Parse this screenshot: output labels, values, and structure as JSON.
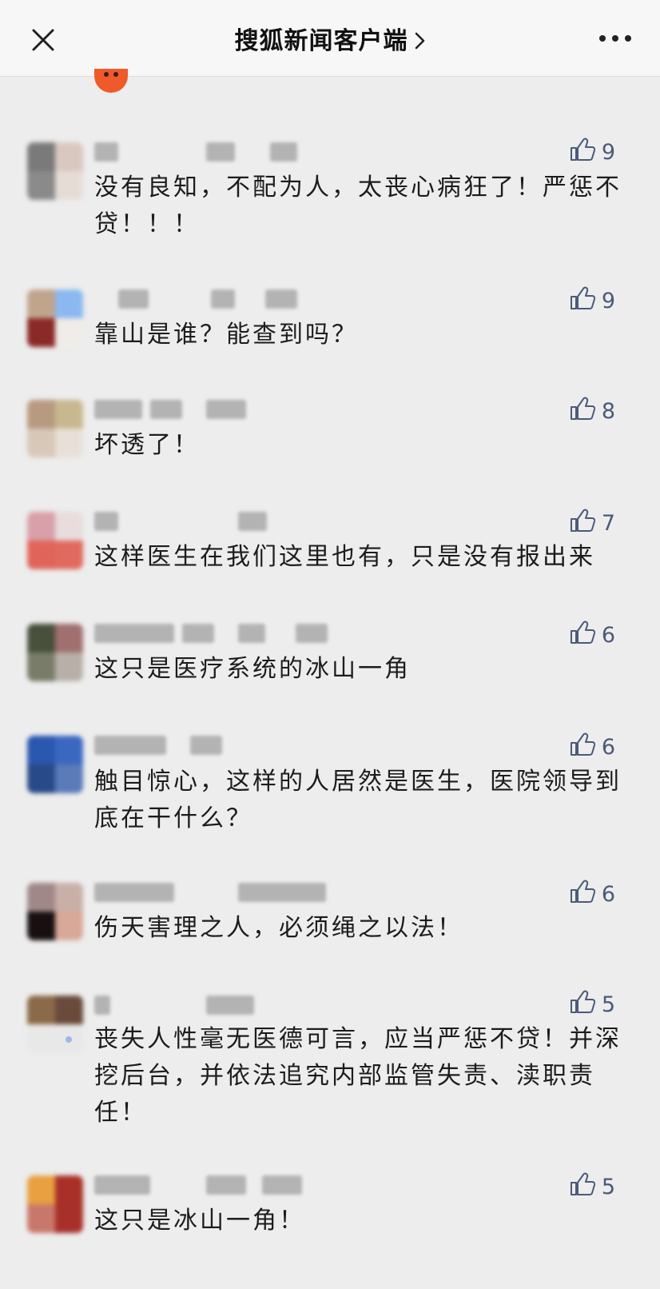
{
  "navbar": {
    "title": "搜狐新闻客户端",
    "close_icon": "close-icon",
    "chevron_icon": "chevron-right-icon",
    "more_icon": "more-icon"
  },
  "comments": [
    {
      "text": "没有良知，不配为人，太丧心病狂了！严惩不贷！！！",
      "likes": "9",
      "avatar_colors": [
        "#7a7a7a",
        "#d8c8c0",
        "#8a8a8a",
        "#e6dcd6"
      ]
    },
    {
      "text": "靠山是谁？能查到吗？",
      "likes": "9",
      "avatar_colors": [
        "#c0a48c",
        "#8bb8f0",
        "#8a2a28",
        "#f0ece8"
      ]
    },
    {
      "text": "坏透了！",
      "likes": "8",
      "avatar_colors": [
        "#b89a80",
        "#c8b890",
        "#d8c8b8",
        "#e8e0d8"
      ]
    },
    {
      "text": "这样医生在我们这里也有，只是没有报出来",
      "likes": "7",
      "avatar_colors": [
        "#d8a0a8",
        "#e8dcdc",
        "#e0645a",
        "#e06a5e"
      ]
    },
    {
      "text": "这只是医疗系统的冰山一角",
      "likes": "6",
      "avatar_colors": [
        "#48503c",
        "#a07070",
        "#787c68",
        "#b8b0a8"
      ]
    },
    {
      "text": "触目惊心，这样的人居然是医生，医院领导到底在干什么？",
      "likes": "6",
      "avatar_colors": [
        "#2a58b0",
        "#3a68c0",
        "#284a88",
        "#5a7ab8"
      ]
    },
    {
      "text": "伤天害理之人，必须绳之以法！",
      "likes": "6",
      "avatar_colors": [
        "#a08888",
        "#c8b0a8",
        "#181010",
        "#d8a898"
      ]
    },
    {
      "text": "丧失人性毫无医德可言，应当严惩不贷！并深挖后台，并依法追究内部监管失责、渎职责任！",
      "likes": "5",
      "avatar_colors": [
        "#8a6a48",
        "#6a4a3a",
        "#e8e8e8",
        "#e8e8e8"
      ]
    },
    {
      "text": "这只是冰山一角！",
      "likes": "5",
      "avatar_colors": [
        "#e8a040",
        "#a83028",
        "#c8786a",
        "#a8302a"
      ]
    }
  ],
  "colors": {
    "background": "#ededed",
    "navbar": "#f7f7f7",
    "like_color": "#4a5a7a"
  }
}
